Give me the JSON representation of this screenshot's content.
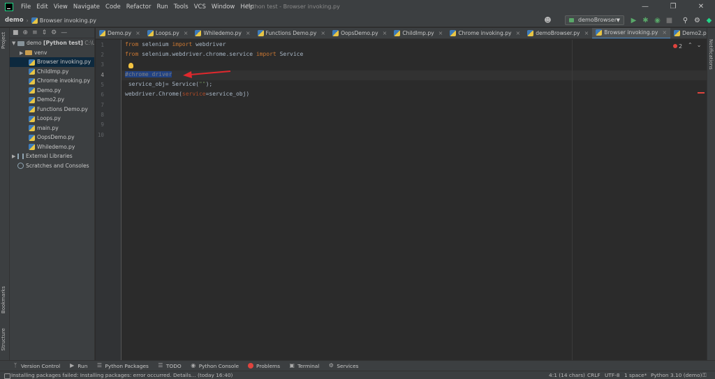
{
  "menu": {
    "items": [
      "File",
      "Edit",
      "View",
      "Navigate",
      "Code",
      "Refactor",
      "Run",
      "Tools",
      "VCS",
      "Window",
      "Help"
    ],
    "window_title": "Python test - Browser invoking.py"
  },
  "navbar": {
    "project": "demo",
    "file": "Browser invoking.py",
    "run_config": "demoBrowser"
  },
  "sidebar": {
    "tab_project": "Project",
    "tab_bookmarks": "Bookmarks",
    "tab_structure": "Structure",
    "tab_notifications": "Notifications"
  },
  "project_tree": {
    "root_name": "demo",
    "root_label": "[Python test]",
    "root_path": "C:\\U",
    "venv": "venv",
    "files": [
      "Browser invoking.py",
      "ChildImp.py",
      "Chrome invoking.py",
      "Demo.py",
      "Demo2.py",
      "Functions Demo.py",
      "Loops.py",
      "main.py",
      "OopsDemo.py",
      "Whiledemo.py"
    ],
    "external_libraries": "External Libraries",
    "scratches": "Scratches and Consoles"
  },
  "editor_tabs": [
    "Demo.py",
    "Loops.py",
    "Whiledemo.py",
    "Functions Demo.py",
    "OopsDemo.py",
    "ChildImp.py",
    "Chrome invoking.py",
    "demoBrowser.py",
    "Browser invoking.py",
    "Demo2.py"
  ],
  "editor": {
    "line_numbers": [
      "1",
      "2",
      "3",
      "4",
      "5",
      "6",
      "7",
      "8",
      "9",
      "10"
    ],
    "code": {
      "l1_kw1": "from",
      "l1_mod": " selenium ",
      "l1_kw2": "import",
      "l1_name": " webdriver",
      "l2_kw1": "from",
      "l2_mod": " selenium.webdriver.chrome.service ",
      "l2_kw2": "import",
      "l2_name": " Service",
      "l4_comment": "#chrome driver",
      "l5_a": " service_obj= Service(",
      "l5_str": "\"\"",
      "l5_b": ");",
      "l6_a": "webdriver.Chrome(",
      "l6_param": "service",
      "l6_b": "=service_obj)"
    },
    "error_count": "2"
  },
  "bottom_tools": [
    "Version Control",
    "Run",
    "Python Packages",
    "TODO",
    "Python Console",
    "Problems",
    "Terminal",
    "Services"
  ],
  "statusbar": {
    "message": "Installing packages failed: Installing packages: error occurred. Details... (today 16:40)",
    "position": "4:1 (14 chars)",
    "line_sep": "CRLF",
    "encoding": "UTF-8",
    "indent": "1 space*",
    "interpreter": "Python 3.10 (demo)"
  },
  "colors": {
    "keyword": "#cc7832",
    "comment": "#808080",
    "string": "#6a8759",
    "annotation_arrow": "#e0282d"
  }
}
